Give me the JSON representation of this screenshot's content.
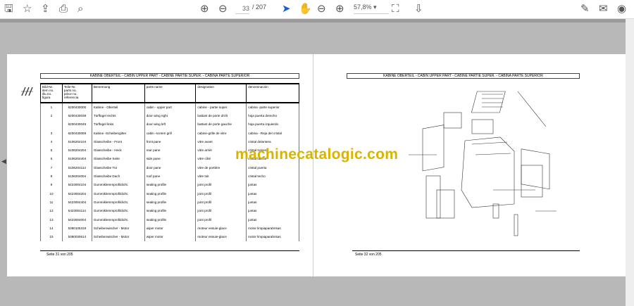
{
  "toolbar": {
    "page_current": "33",
    "page_total": "/ 207",
    "zoom": "57,8%",
    "icons": [
      "save-icon",
      "bookmark-star-icon",
      "upload-icon",
      "print-icon",
      "search-icon",
      "page-up-icon",
      "page-down-icon",
      "select-cursor-icon",
      "hand-icon",
      "zoom-out-icon",
      "zoom-in-icon",
      "fit-page-icon",
      "scroll-mode-icon",
      "sign-icon",
      "email-icon",
      "account-icon"
    ]
  },
  "left_page": {
    "title": "KABINE OBERTEIL - CABIN UPPER PART - CABINE PARTIE SUPER. - CABINA PARTE SUPERIOR",
    "headers": [
      "Bild-Nr.\nitem no.\nillu.no.\nfigura",
      "Teile-Nr.\nparts no.\npièce no.\nreferencia",
      "Benennung",
      "parts name",
      "designation",
      "denominación"
    ],
    "rows": [
      [
        "1",
        "6200430000",
        "Kabine - Oberteil",
        "cabin - upper part",
        "cabine - partie super.",
        "cabina -parte superior"
      ],
      [
        "2",
        "6200430039",
        "Türflügel rechts",
        "door wing right",
        "battant de porte droît",
        "hoja puerta derecho"
      ],
      [
        "",
        "6200430049",
        "Türflügel links",
        "door wing left",
        "battant de porte gauche",
        "hoja puerta izquierdo"
      ],
      [
        "3",
        "6200430059",
        "Kabine -Scheibengitter",
        "cabin -screen grill",
        "cabine-grille de vitre",
        "cabina - Reja del cristal"
      ],
      [
        "4",
        "5106204104",
        "Glasscheibe - Front",
        "front pane",
        "vitre avant",
        "cristal delantera"
      ],
      [
        "5",
        "5106204204",
        "Glasscheibe - Heck",
        "rear pane",
        "vitre arrièr",
        "cristal trasera"
      ],
      [
        "6",
        "5106204404",
        "Glasscheibe Seite",
        "side pane",
        "vitre côté",
        "cristal lateral"
      ],
      [
        "7",
        "5106204114",
        "Glasscheibe Tür",
        "door pane",
        "vitre de portière",
        "cristal puerta"
      ],
      [
        "8",
        "5106204004",
        "Glasscheibe Dach",
        "roof pane",
        "vitre toit",
        "cristal techo"
      ],
      [
        "9",
        "5423004104",
        "Gummiklemmprofildicht.",
        "sealing profile",
        "joint profil",
        "juntas"
      ],
      [
        "10",
        "5423004204",
        "Gummiklemmprofildicht.",
        "sealing profile",
        "joint profil",
        "juntas"
      ],
      [
        "11",
        "5423004404",
        "Gummiklemmprofildicht.",
        "sealing profile",
        "joint profil",
        "juntas"
      ],
      [
        "12",
        "5423004114",
        "Gummiklemmprofildicht.",
        "sealing profile",
        "joint profil",
        "juntas"
      ],
      [
        "13",
        "5423004004",
        "Gummiklemmprofildicht.",
        "sealing profile",
        "joint profil",
        "juntas"
      ],
      [
        "14",
        "5380105319",
        "Scheibenwischer - Motor",
        "wiper motor",
        "moteur essuie-glace",
        "motor limpiaparabrisas"
      ],
      [
        "15",
        "5380030614",
        "Scheibenwischer - Motor",
        "wiper motor",
        "moteur essuie-glace",
        "motor limpiaparabrisas"
      ]
    ],
    "footer": "Seite 31 von 205"
  },
  "right_page": {
    "title": "KABINE OBERTEIL - CABIN UPPER PART - CABINE PARTIE SUPER. - CABINA PARTE SUPERIOR",
    "footer": "Seite 32 von 205"
  },
  "watermark": "machinecatalogic.com"
}
